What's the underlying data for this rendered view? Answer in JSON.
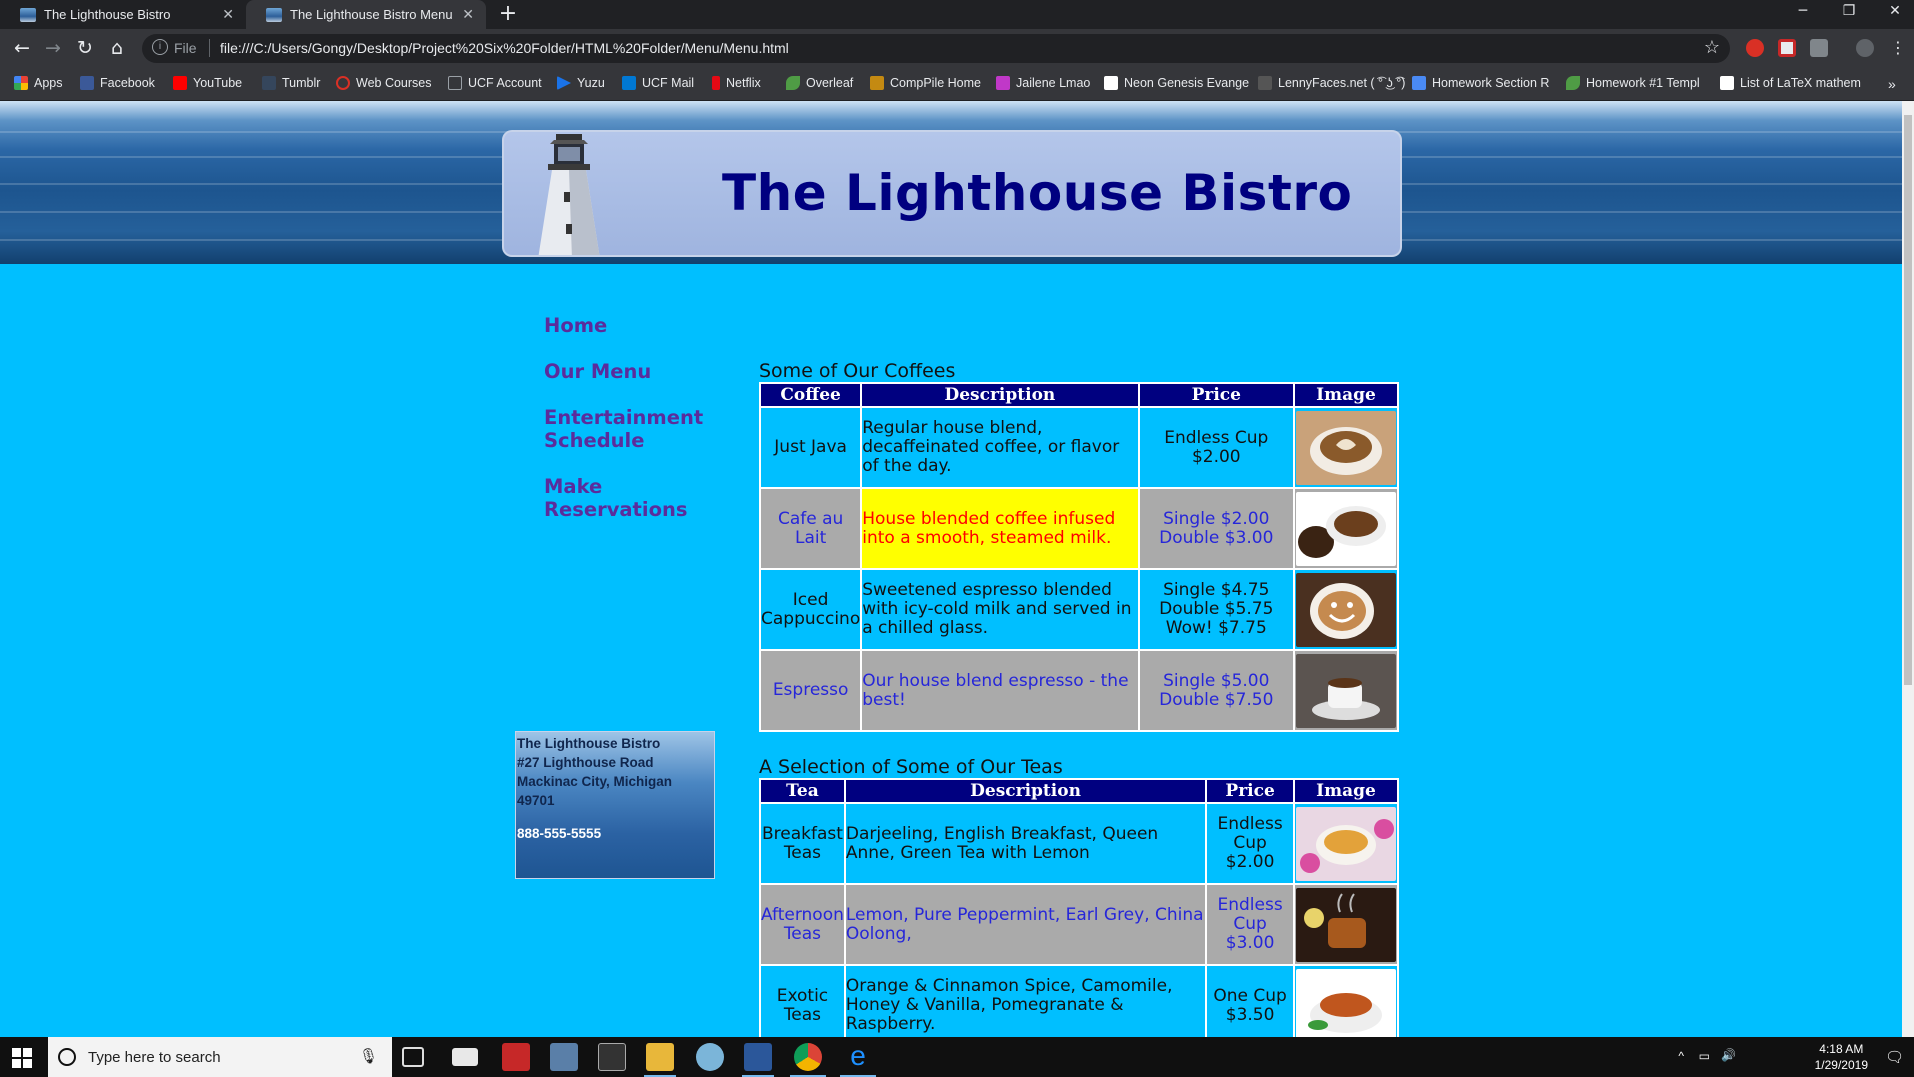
{
  "browser": {
    "tabs": [
      {
        "title": "The Lighthouse Bistro"
      },
      {
        "title": "The Lighthouse Bistro Menu"
      }
    ],
    "address": {
      "scheme": "File",
      "url": "file:///C:/Users/Gongy/Desktop/Project%20Six%20Folder/HTML%20Folder/Menu/Menu.html"
    },
    "bookmarks": [
      {
        "label": "Apps",
        "color": "#e94235"
      },
      {
        "label": "Facebook",
        "color": "#3b5998"
      },
      {
        "label": "YouTube",
        "color": "#ff0000"
      },
      {
        "label": "Tumblr",
        "color": "#35465c"
      },
      {
        "label": "Web Courses",
        "color": "#d93025"
      },
      {
        "label": "UCF Account",
        "color": "#9aa0a6"
      },
      {
        "label": "Yuzu",
        "color": "#1a73e8"
      },
      {
        "label": "UCF Mail",
        "color": "#0078d4"
      },
      {
        "label": "Netflix",
        "color": "#e50914"
      },
      {
        "label": "Overleaf",
        "color": "#4f9c45"
      },
      {
        "label": "CompPile Home",
        "color": "#c48a12"
      },
      {
        "label": "Jailene Lmao",
        "color": "#c038c8"
      },
      {
        "label": "Neon Genesis Evange",
        "color": "#ffffff"
      },
      {
        "label": "LennyFaces.net ( ͡° ͜ʖ ͡°)",
        "color": "#555555"
      },
      {
        "label": "Homework Section R",
        "color": "#4a8af4"
      },
      {
        "label": "Homework #1 Templ",
        "color": "#4f9c45"
      },
      {
        "label": "List of LaTeX mathem",
        "color": "#ffffff"
      }
    ]
  },
  "site": {
    "title": "The Lighthouse Bistro",
    "nav": [
      "Home",
      "Our Menu",
      "Entertainment Schedule",
      "Make Reservations"
    ],
    "address": {
      "name": "The Lighthouse Bistro",
      "street": "#27 Lighthouse Road",
      "city": "Mackinac City, Michigan",
      "zip": "49701",
      "phone": "888-555-5555"
    }
  },
  "coffees": {
    "caption": "Some of Our Coffees",
    "headers": [
      "Coffee",
      "Description",
      "Price",
      "Image"
    ],
    "rows": [
      {
        "name": "Just Java",
        "desc": "Regular house blend, decaffeinated coffee, or flavor of the day.",
        "price": [
          "Endless Cup $2.00"
        ]
      },
      {
        "name": "Cafe au Lait",
        "desc": "House blended coffee infused into a smooth, steamed milk.",
        "price": [
          "Single $2.00",
          "Double $3.00"
        ]
      },
      {
        "name": "Iced Cappuccino",
        "desc": "Sweetened espresso blended with icy-cold milk and served in a chilled glass.",
        "price": [
          "Single $4.75",
          "Double $5.75",
          "Wow! $7.75"
        ]
      },
      {
        "name": "Espresso",
        "desc": "Our house blend espresso - the best!",
        "price": [
          "Single $5.00",
          "Double $7.50"
        ]
      }
    ]
  },
  "teas": {
    "caption": "A Selection of Some of Our Teas",
    "headers": [
      "Tea",
      "Description",
      "Price",
      "Image"
    ],
    "rows": [
      {
        "name": "Breakfast Teas",
        "desc": "Darjeeling, English Breakfast, Queen Anne, Green Tea with Lemon",
        "price": [
          "Endless Cup $2.00"
        ]
      },
      {
        "name": "Afternoon Teas",
        "desc": "Lemon, Pure Peppermint, Earl Grey, China Oolong,",
        "price": [
          "Endless Cup $3.00"
        ]
      },
      {
        "name": "Exotic Teas",
        "desc": "Orange & Cinnamon Spice, Camomile, Honey & Vanilla, Pomegranate & Raspberry.",
        "price": [
          "One Cup $3.50"
        ]
      }
    ]
  },
  "taskbar": {
    "search_placeholder": "Type here to search",
    "time": "4:18 AM",
    "date": "1/29/2019"
  },
  "colors": {
    "page_bg": "#00bfff",
    "header_text": "#000080",
    "nav_text": "#5b2c9c",
    "table_header_bg": "#000080",
    "highlight_bg": "#ffff00",
    "highlight_text": "#ff0000",
    "alt_row_bg": "#aaaaaa",
    "alt_row_text": "#2626d9"
  }
}
